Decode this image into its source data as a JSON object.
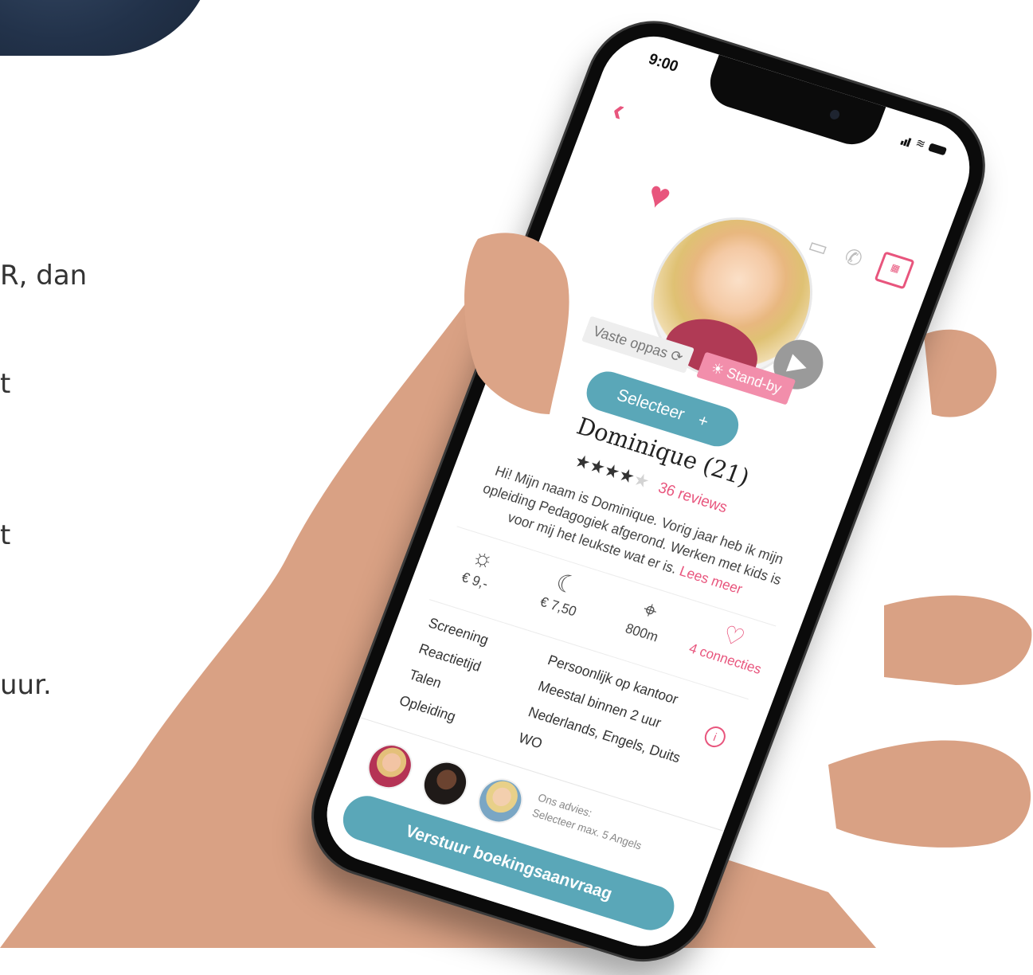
{
  "page": {
    "fragments": [
      "R, dan",
      "t",
      "t",
      "uur."
    ]
  },
  "status": {
    "time": "9:00"
  },
  "profile": {
    "tag_vaste": "Vaste oppas",
    "tag_standby": "Stand-by",
    "select_label": "Selecteer",
    "select_plus": "+",
    "name": "Dominique (21)",
    "stars_filled": "★★★★",
    "stars_empty": "★",
    "rating_value": 4,
    "rating_max": 5,
    "reviews": "36 reviews",
    "bio": "Hi! Mijn naam is Dominique. Vorig jaar heb ik mijn opleiding Pedagogiek afgerond. Werken met kids is voor mij het leukste wat er is.",
    "read_more": "Lees meer"
  },
  "stats": [
    {
      "icon": "sun-icon",
      "glyph": "☼",
      "value": "€ 9,-"
    },
    {
      "icon": "moon-icon",
      "glyph": "☾",
      "value": "€ 7,50"
    },
    {
      "icon": "location-pin-icon",
      "glyph": "⌖",
      "value": "800m"
    },
    {
      "icon": "connections-icon",
      "glyph": "♡",
      "value": "4 connecties"
    }
  ],
  "details": [
    {
      "label": "Screening",
      "value": "Persoonlijk op kantoor"
    },
    {
      "label": "Reactietijd",
      "value": "Meestal binnen 2 uur"
    },
    {
      "label": "Talen",
      "value": "Nederlands, Engels, Duits"
    },
    {
      "label": "Opleiding",
      "value": "WO"
    }
  ],
  "footer": {
    "advice_title": "Ons advies:",
    "advice_text": "Selecteer max. 5 Angels",
    "send_label": "Verstuur boekingsaanvraag"
  },
  "colors": {
    "accent_pink": "#e8557d",
    "accent_teal": "#5aa7b8"
  }
}
